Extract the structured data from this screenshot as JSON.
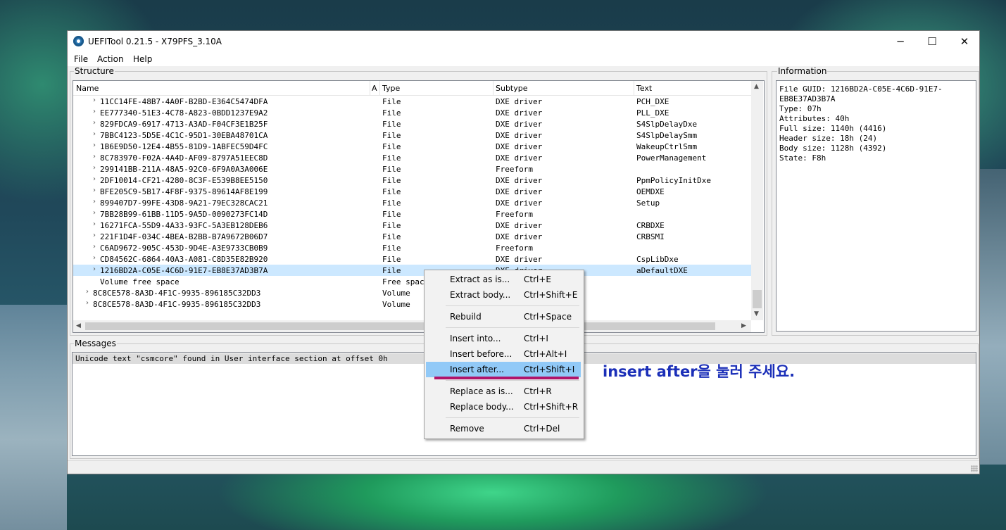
{
  "window": {
    "title": "UEFITool 0.21.5 - X79PFS_3.10A",
    "controls": {
      "minimize": "─",
      "maximize": "☐",
      "close": "✕"
    }
  },
  "menu": {
    "file": "File",
    "action": "Action",
    "help": "Help"
  },
  "structure": {
    "label": "Structure",
    "columns": {
      "name": "Name",
      "action": "A",
      "type": "Type",
      "subtype": "Subtype",
      "text": "Text"
    },
    "rows": [
      {
        "name": "11CC14FE-48B7-4A0F-B2BD-E364C5474DFA",
        "type": "File",
        "subtype": "DXE driver",
        "text": "PCH_DXE"
      },
      {
        "name": "EE777340-51E3-4C78-A823-0BDD1237E9A2",
        "type": "File",
        "subtype": "DXE driver",
        "text": "PLL_DXE"
      },
      {
        "name": "829FDCA9-6917-4713-A3AD-F04CF3E1B25F",
        "type": "File",
        "subtype": "DXE driver",
        "text": "S4SlpDelayDxe"
      },
      {
        "name": "7BBC4123-5D5E-4C1C-95D1-30EBA48701CA",
        "type": "File",
        "subtype": "DXE driver",
        "text": "S4SlpDelaySmm"
      },
      {
        "name": "1B6E9D50-12E4-4B55-81D9-1ABFEC59D4FC",
        "type": "File",
        "subtype": "DXE driver",
        "text": "WakeupCtrlSmm"
      },
      {
        "name": "8C783970-F02A-4A4D-AF09-8797A51EEC8D",
        "type": "File",
        "subtype": "DXE driver",
        "text": "PowerManagement"
      },
      {
        "name": "299141BB-211A-48A5-92C0-6F9A0A3A006E",
        "type": "File",
        "subtype": "Freeform",
        "text": ""
      },
      {
        "name": "2DF10014-CF21-4280-8C3F-E539B8EE5150",
        "type": "File",
        "subtype": "DXE driver",
        "text": "PpmPolicyInitDxe"
      },
      {
        "name": "BFE205C9-5B17-4F8F-9375-89614AF8E199",
        "type": "File",
        "subtype": "DXE driver",
        "text": "OEMDXE"
      },
      {
        "name": "899407D7-99FE-43D8-9A21-79EC328CAC21",
        "type": "File",
        "subtype": "DXE driver",
        "text": "Setup"
      },
      {
        "name": "7BB28B99-61BB-11D5-9A5D-0090273FC14D",
        "type": "File",
        "subtype": "Freeform",
        "text": ""
      },
      {
        "name": "16271FCA-55D9-4A33-93FC-5A3EB128DEB6",
        "type": "File",
        "subtype": "DXE driver",
        "text": "CRBDXE"
      },
      {
        "name": "221F1D4F-034C-4BEA-B2BB-B7A9672B06D7",
        "type": "File",
        "subtype": "DXE driver",
        "text": "CRBSMI"
      },
      {
        "name": "C6AD9672-905C-453D-9D4E-A3E9733CB0B9",
        "type": "File",
        "subtype": "Freeform",
        "text": ""
      },
      {
        "name": "CD84562C-6864-40A3-A081-C8D35E82B920",
        "type": "File",
        "subtype": "DXE driver",
        "text": "CspLibDxe"
      },
      {
        "name": "1216BD2A-C05E-4C6D-91E7-EB8E37AD3B7A",
        "type": "File",
        "subtype": "DXE driver",
        "text": "aDefaultDXE",
        "selected": true
      },
      {
        "name": "Volume free space",
        "type": "Free space",
        "subtype": "",
        "text": "",
        "noExpander": true
      },
      {
        "name": "8C8CE578-8A3D-4F1C-9935-896185C32DD3",
        "type": "Volume",
        "subtype": "",
        "text": "",
        "level": 0
      },
      {
        "name": "8C8CE578-8A3D-4F1C-9935-896185C32DD3",
        "type": "Volume",
        "subtype": "",
        "text": "",
        "level": 0
      }
    ]
  },
  "information": {
    "label": "Information",
    "lines": [
      "File GUID: 1216BD2A-C05E-4C6D-91E7-",
      "EB8E37AD3B7A",
      "Type: 07h",
      "Attributes: 40h",
      "Full size: 1140h (4416)",
      "Header size: 18h (24)",
      "Body size: 1128h (4392)",
      "State: F8h"
    ]
  },
  "messages": {
    "label": "Messages",
    "line": "Unicode text \"csmcore\" found in User interface section at offset 0h"
  },
  "context_menu": {
    "groups": [
      [
        {
          "label": "Extract as is...",
          "shortcut": "Ctrl+E"
        },
        {
          "label": "Extract body...",
          "shortcut": "Ctrl+Shift+E"
        }
      ],
      [
        {
          "label": "Rebuild",
          "shortcut": "Ctrl+Space"
        }
      ],
      [
        {
          "label": "Insert into...",
          "shortcut": "Ctrl+I"
        },
        {
          "label": "Insert before...",
          "shortcut": "Ctrl+Alt+I"
        },
        {
          "label": "Insert after...",
          "shortcut": "Ctrl+Shift+I",
          "highlighted": true
        }
      ],
      [
        {
          "label": "Replace as is...",
          "shortcut": "Ctrl+R"
        },
        {
          "label": "Replace body...",
          "shortcut": "Ctrl+Shift+R"
        }
      ],
      [
        {
          "label": "Remove",
          "shortcut": "Ctrl+Del"
        }
      ]
    ]
  },
  "annotation": {
    "text": "insert after을 눌러 주세요."
  },
  "colors": {
    "selection": "#cce8ff",
    "menu_highlight": "#91c9f7",
    "annotation": "#1b2fb8",
    "underline": "#b0146a"
  }
}
